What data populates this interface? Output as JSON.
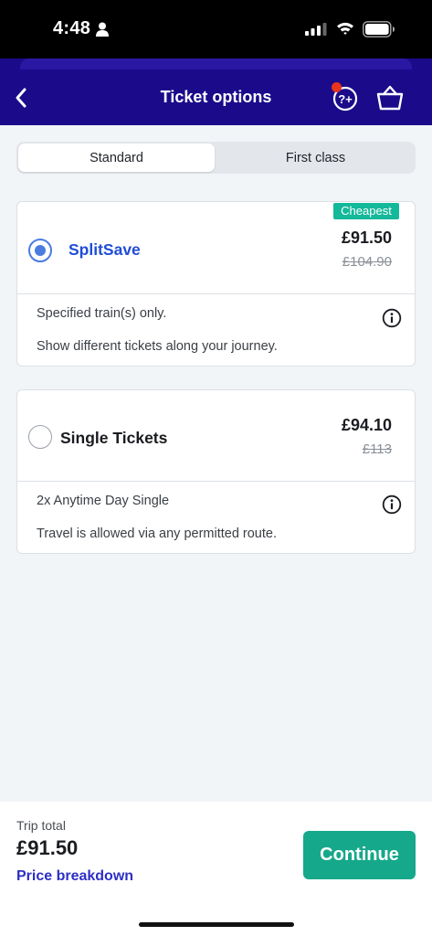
{
  "status_bar": {
    "time": "4:48"
  },
  "header": {
    "title": "Ticket options"
  },
  "segment": {
    "standard_label": "Standard",
    "first_class_label": "First class",
    "selected": "Standard"
  },
  "tickets": [
    {
      "name": "SplitSave",
      "badge": "Cheapest",
      "price": "£91.50",
      "old_price": "£104.90",
      "selected": true,
      "lines": [
        "Specified train(s) only.",
        "Show different tickets along your journey."
      ]
    },
    {
      "name": "Single Tickets",
      "price": "£94.10",
      "old_price": "£113",
      "selected": false,
      "lines": [
        "2x Anytime Day Single",
        "Travel is allowed via any permitted route."
      ]
    }
  ],
  "footer": {
    "trip_label": "Trip total",
    "trip_total": "£91.50",
    "breakdown_label": "Price breakdown",
    "continue_label": "Continue"
  },
  "colors": {
    "nav": "#1b0a8a",
    "accent_green": "#16a88a",
    "link_blue": "#2d2fc4",
    "badge_green": "#14b89a"
  },
  "icons": [
    "person-icon",
    "signal-icon",
    "wifi-icon",
    "battery-icon",
    "back-arrow-icon",
    "help-icon",
    "basket-icon",
    "info-icon"
  ]
}
